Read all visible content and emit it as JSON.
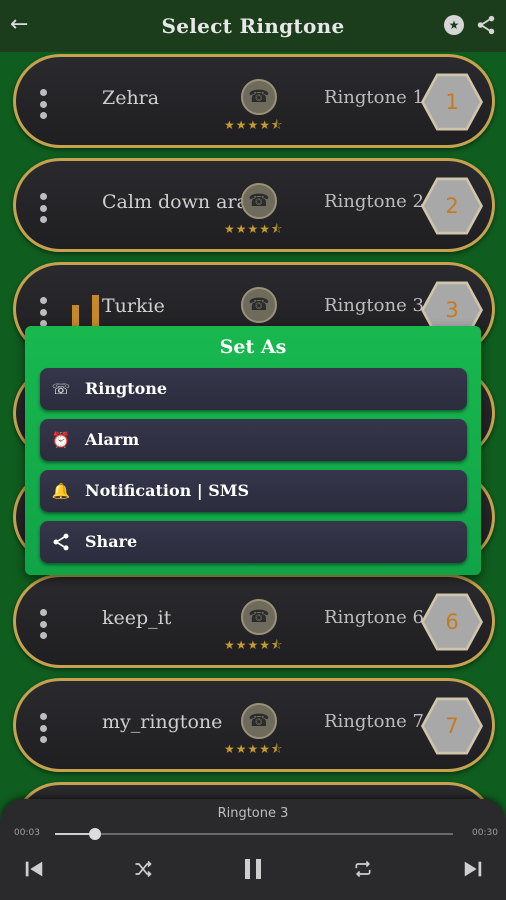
{
  "header": {
    "title": "Select Ringtone",
    "back_icon": "arrow-left-icon",
    "star_icon": "star-circle-icon",
    "share_icon": "share-icon"
  },
  "ringtones": [
    {
      "name": "Zehra",
      "label": "Ringtone 1",
      "number": "1",
      "rating": "★★★★⯪"
    },
    {
      "name": "Calm down arab",
      "label": "Ringtone 2",
      "number": "2",
      "rating": "★★★★⯪"
    },
    {
      "name": "Turkie",
      "label": "Ringtone 3",
      "number": "3",
      "rating": "★★★★⯪"
    },
    {
      "name": "keep_it",
      "label": "Ringtone 6",
      "number": "6",
      "rating": "★★★★⯪"
    },
    {
      "name": "my_ringtone",
      "label": "Ringtone 7",
      "number": "7",
      "rating": "★★★★⯪"
    }
  ],
  "dialog": {
    "title": "Set As",
    "options": [
      {
        "label": "Ringtone",
        "icon": "phone-ringing-icon"
      },
      {
        "label": "Alarm",
        "icon": "alarm-clock-icon"
      },
      {
        "label": "Notification | SMS",
        "icon": "bell-icon"
      },
      {
        "label": "Share",
        "icon": "share-icon"
      }
    ]
  },
  "player": {
    "now_playing": "Ringtone 3",
    "time_start": "00:03",
    "time_end": "00:30",
    "progress": 0.1,
    "controls": [
      "skip-previous-icon",
      "shuffle-icon",
      "pause-icon",
      "repeat-icon",
      "skip-next-icon"
    ]
  },
  "colors": {
    "background": "#0f5d1f",
    "topbar": "#1b3d1c",
    "card_border": "#c6a24e",
    "dialog": "#18b84f",
    "number": "#c57b1e"
  }
}
